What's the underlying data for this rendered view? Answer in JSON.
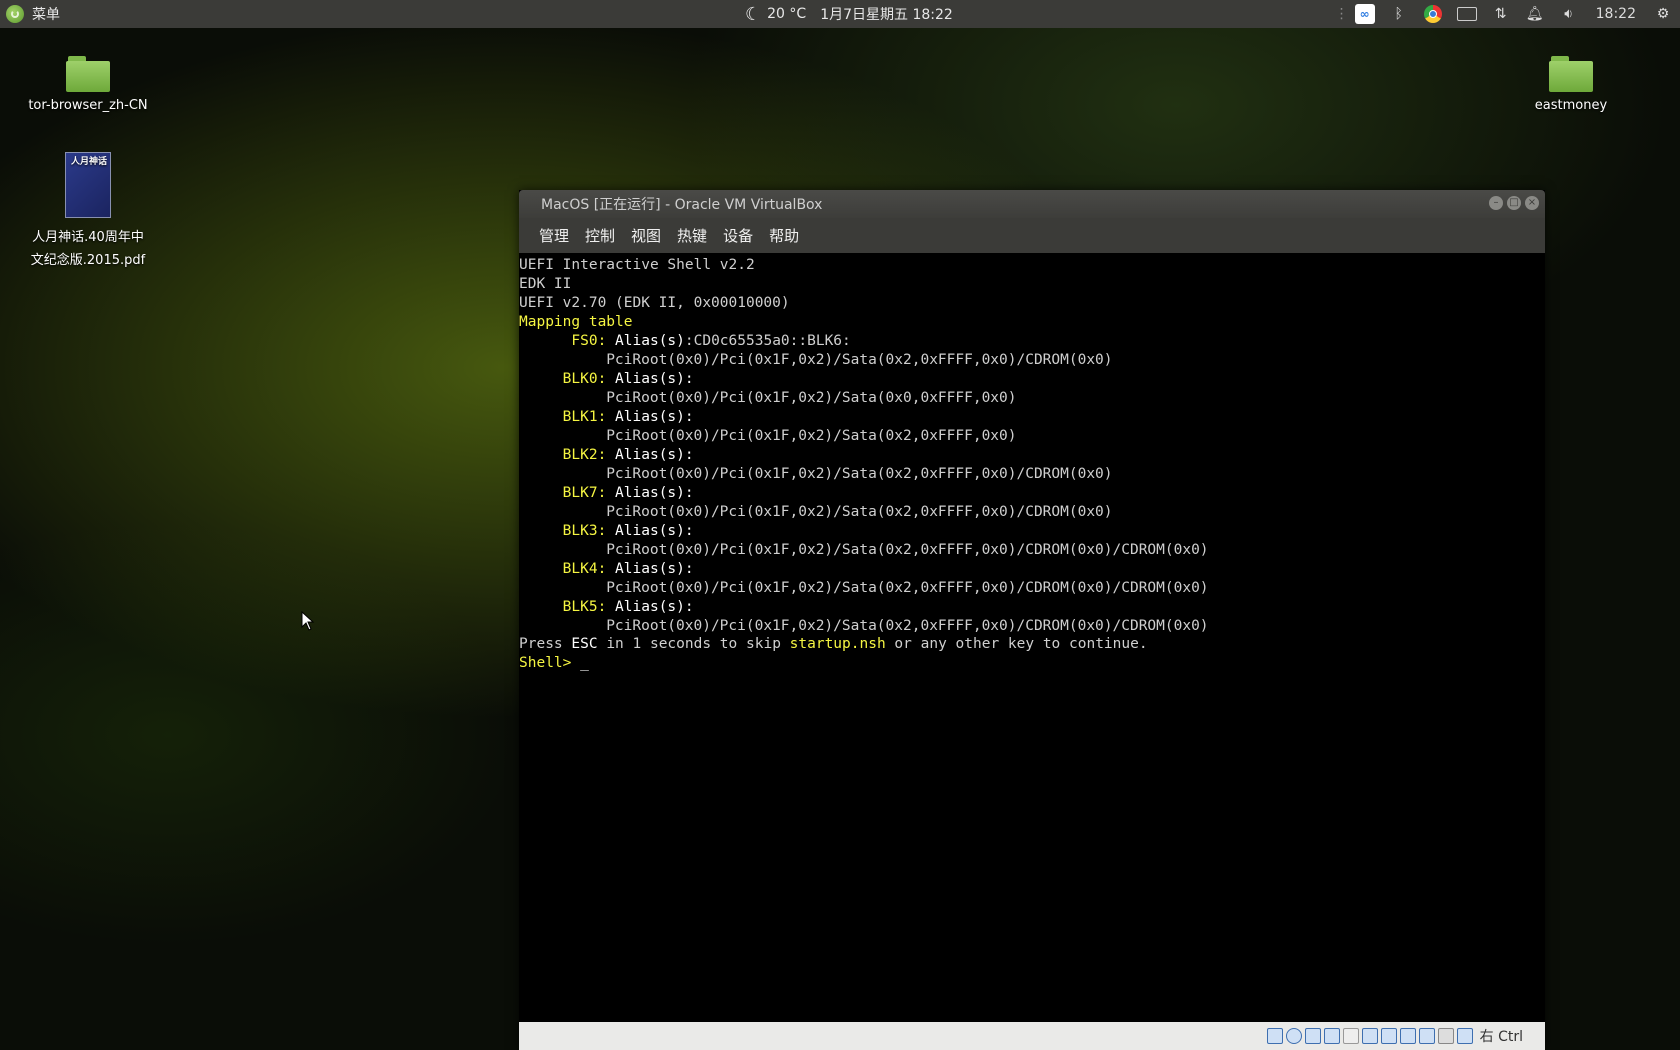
{
  "topbar": {
    "menu_label": "菜单",
    "weather": "20 °C",
    "datetime": "1月7日星期五 18:22",
    "clock": "18:22",
    "tray_icons": [
      "baidu-netdisk-icon",
      "bluetooth-icon",
      "chrome-icon",
      "keyboard-icon",
      "network-icon",
      "notification-icon",
      "volume-icon",
      "settings-icon"
    ]
  },
  "desktop": {
    "icons": [
      {
        "label": "tor-browser_zh-CN",
        "type": "folder"
      },
      {
        "label_line1": "人月神话.40周年中",
        "label_line2": "文纪念版.2015.pdf",
        "type": "pdf",
        "cover_text": "人月神话"
      },
      {
        "label": "eastmoney",
        "type": "folder"
      }
    ]
  },
  "vbox": {
    "title": "MacOS [正在运行] - Oracle VM VirtualBox",
    "menu": [
      "管理",
      "控制",
      "视图",
      "热键",
      "设备",
      "帮助"
    ],
    "host_key": "右 Ctrl",
    "console": {
      "l1": "UEFI Interactive Shell v2.2",
      "l2": "EDK II",
      "l3": "UEFI v2.70 (EDK II, 0x00010000)",
      "l4": "Mapping table",
      "maps": [
        {
          "dev": "FS0:",
          "alias": " Alias(s)",
          "alias_val": ":CD0c65535a0::BLK6:",
          "path": "PciRoot(0x0)/Pci(0x1F,0x2)/Sata(0x2,0xFFFF,0x0)/CDROM(0x0)"
        },
        {
          "dev": "BLK0:",
          "alias": " Alias(s):",
          "alias_val": "",
          "path": "PciRoot(0x0)/Pci(0x1F,0x2)/Sata(0x0,0xFFFF,0x0)"
        },
        {
          "dev": "BLK1:",
          "alias": " Alias(s):",
          "alias_val": "",
          "path": "PciRoot(0x0)/Pci(0x1F,0x2)/Sata(0x2,0xFFFF,0x0)"
        },
        {
          "dev": "BLK2:",
          "alias": " Alias(s):",
          "alias_val": "",
          "path": "PciRoot(0x0)/Pci(0x1F,0x2)/Sata(0x2,0xFFFF,0x0)/CDROM(0x0)"
        },
        {
          "dev": "BLK7:",
          "alias": " Alias(s):",
          "alias_val": "",
          "path": "PciRoot(0x0)/Pci(0x1F,0x2)/Sata(0x2,0xFFFF,0x0)/CDROM(0x0)"
        },
        {
          "dev": "BLK3:",
          "alias": " Alias(s):",
          "alias_val": "",
          "path": "PciRoot(0x0)/Pci(0x1F,0x2)/Sata(0x2,0xFFFF,0x0)/CDROM(0x0)/CDROM(0x0)"
        },
        {
          "dev": "BLK4:",
          "alias": " Alias(s):",
          "alias_val": "",
          "path": "PciRoot(0x0)/Pci(0x1F,0x2)/Sata(0x2,0xFFFF,0x0)/CDROM(0x0)/CDROM(0x0)"
        },
        {
          "dev": "BLK5:",
          "alias": " Alias(s):",
          "alias_val": "",
          "path": "PciRoot(0x0)/Pci(0x1F,0x2)/Sata(0x2,0xFFFF,0x0)/CDROM(0x0)/CDROM(0x0)"
        }
      ],
      "press_a": "Press ",
      "press_esc": "ESC",
      "press_b": " in 1 seconds to skip ",
      "press_nsh": "startup.nsh",
      "press_c": " or any other key to continue.",
      "prompt": "Shell> ",
      "cursor": "_"
    }
  }
}
